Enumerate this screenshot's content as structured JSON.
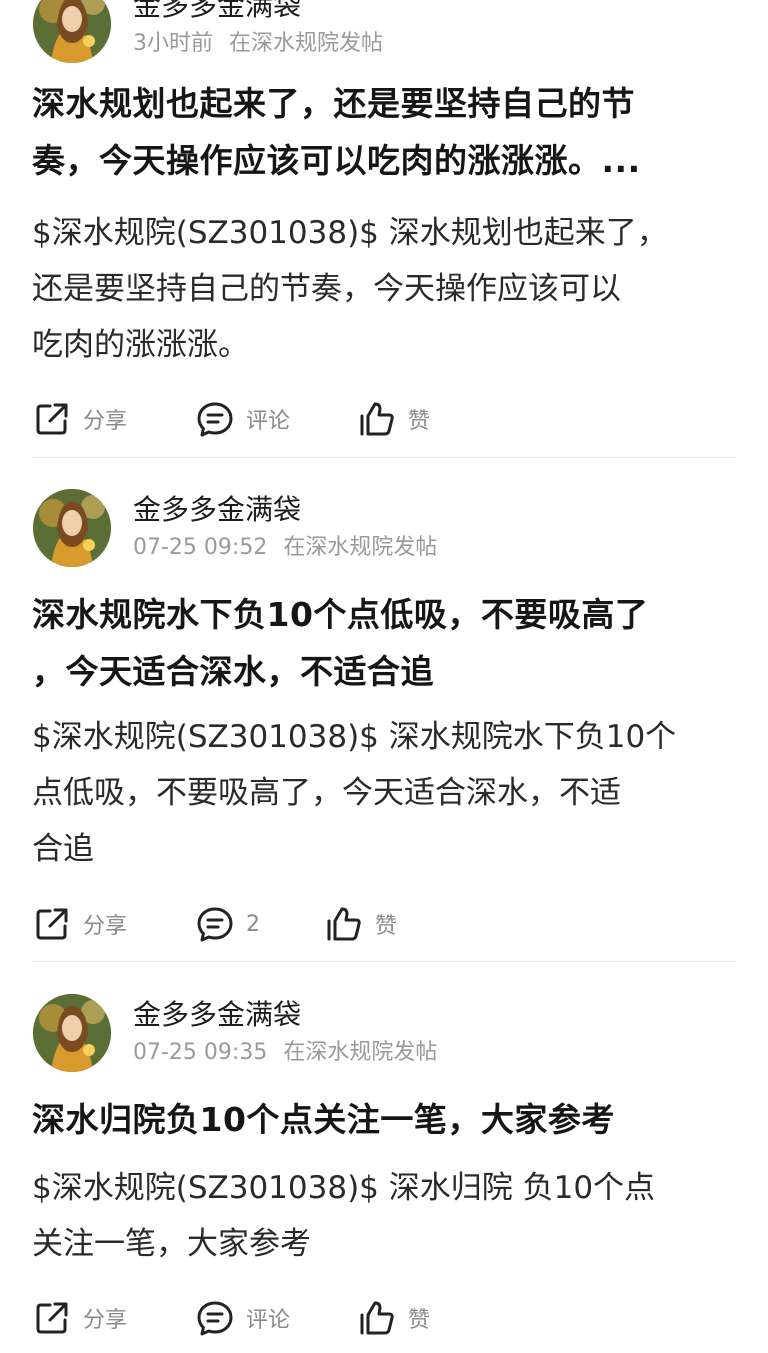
{
  "posts": [
    {
      "author": "金多多金满袋",
      "time": "3小时前",
      "source": "在深水规院发帖",
      "title_lines": [
        "深水规划也起来了，还是要坚持自己的节",
        "奏，今天操作应该可以吃肉的涨涨涨。..."
      ],
      "body_lines": [
        "$深水规院(SZ301038)$ 深水规划也起来了，",
        "还是要坚持自己的节奏，今天操作应该可以",
        "吃肉的涨涨涨。"
      ],
      "actions": {
        "share": "分享",
        "comment": "评论",
        "like": "赞"
      }
    },
    {
      "author": "金多多金满袋",
      "time": "07-25 09:52",
      "source": "在深水规院发帖",
      "title_lines": [
        "深水规院水下负10个点低吸，不要吸高了",
        "，今天适合深水，不适合追"
      ],
      "body_lines": [
        "$深水规院(SZ301038)$ 深水规院水下负10个",
        "点低吸，不要吸高了，今天适合深水，不适",
        "合追"
      ],
      "actions": {
        "share": "分享",
        "comment": "2",
        "like": "赞"
      }
    },
    {
      "author": "金多多金满袋",
      "time": "07-25 09:35",
      "source": "在深水规院发帖",
      "title_lines": [
        "深水归院负10个点关注一笔，大家参考"
      ],
      "body_lines": [
        "$深水规院(SZ301038)$ 深水归院 负10个点",
        "关注一笔，大家参考"
      ],
      "actions": {
        "share": "分享",
        "comment": "评论",
        "like": "赞"
      }
    }
  ],
  "icons": {
    "share": "share-icon",
    "comment": "comment-icon",
    "like": "thumbs-up-icon"
  },
  "colors": {
    "text": "#1f1f1f",
    "meta": "#9a9a9a",
    "action_label": "#8a8a8a",
    "divider": "#e8e8e8"
  }
}
